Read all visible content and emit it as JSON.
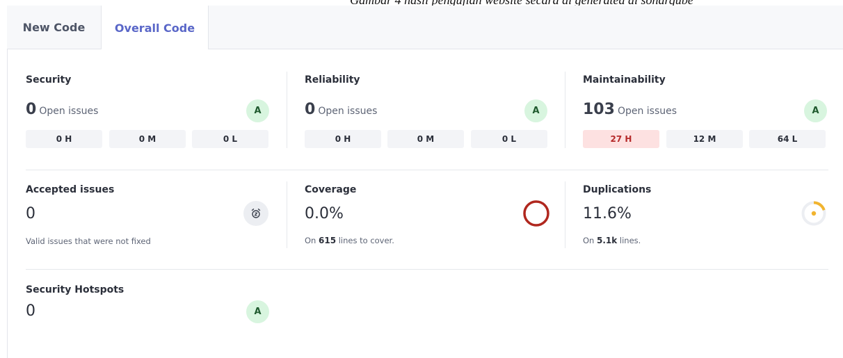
{
  "caption": "Gambar 4 hasil pengujian website secara di generated di sonarqube",
  "tabs": [
    {
      "label": "New Code",
      "active": false
    },
    {
      "label": "Overall Code",
      "active": true
    }
  ],
  "colors": {
    "accent": "#5a67c8",
    "grade_bg": "#d8f5df",
    "high_bg": "#fde1e1",
    "coverage_ring": "#b0271e",
    "duplication_arc": "#f1b42f"
  },
  "security": {
    "title": "Security",
    "count": "0",
    "unit": "Open issues",
    "grade": "A",
    "severity": {
      "high": "0 H",
      "medium": "0 M",
      "low": "0 L"
    }
  },
  "reliability": {
    "title": "Reliability",
    "count": "0",
    "unit": "Open issues",
    "grade": "A",
    "severity": {
      "high": "0 H",
      "medium": "0 M",
      "low": "0 L"
    }
  },
  "maintainability": {
    "title": "Maintainability",
    "count": "103",
    "unit": "Open issues",
    "grade": "A",
    "severity": {
      "high": "27 H",
      "medium": "12 M",
      "low": "64 L"
    }
  },
  "accepted": {
    "title": "Accepted issues",
    "value": "0",
    "description": "Valid issues that were not fixed",
    "icon": "alarm-clock-icon"
  },
  "coverage": {
    "title": "Coverage",
    "value": "0.0%",
    "prefix": "On",
    "lines": "615",
    "suffix": "lines to cover.",
    "percent": 0.0
  },
  "duplications": {
    "title": "Duplications",
    "value": "11.6%",
    "prefix": "On",
    "lines": "5.1k",
    "suffix": "lines.",
    "percent": 11.6
  },
  "hotspots": {
    "title": "Security Hotspots",
    "value": "0",
    "grade": "A"
  }
}
